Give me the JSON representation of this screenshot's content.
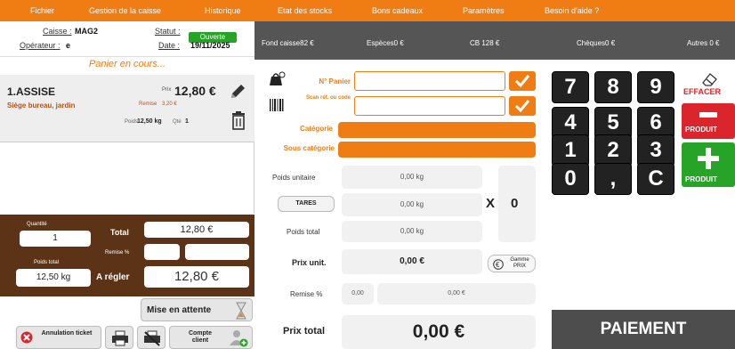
{
  "menu": {
    "items": [
      "Fichier",
      "Gestion de la caisse",
      "Historique",
      "Etat des stocks",
      "Bons cadeaux",
      "Paramètres",
      "Besoin d'aide ?"
    ]
  },
  "header": {
    "caisse_label": "Caisse :",
    "caisse_value": "MAG2",
    "operateur_label": "Opérateur :",
    "operateur_value": "e",
    "statut_label": "Statut :",
    "statut_value": "Ouverte",
    "date_label": "Date :",
    "date_value": "19/11/2025"
  },
  "totals_bar": {
    "fond_caisse": "Fond caisse82 €",
    "especes": "Espèces0 €",
    "cb": "CB 128 €",
    "cheques": "Chèques0 €",
    "autres": "Autres 0 €"
  },
  "cart": {
    "title": "Panier en cours...",
    "item": {
      "name": "1.ASSISE",
      "desc": "Siège bureau, jardin",
      "prix_label": "Prix",
      "prix": "12,80 €",
      "remise_label": "Remise",
      "remise": "3,20 €",
      "poids_label": "Poids",
      "poids": "12,50 kg",
      "qte_label": "Qté",
      "qte": "1"
    }
  },
  "summary": {
    "quantite_label": "Quantité",
    "quantite": "1",
    "total_label": "Total",
    "total": "12,80 €",
    "remise_label": "Remise %",
    "poids_total_label": "Poids total",
    "poids_total": "12,50 kg",
    "a_regler_label": "A régler",
    "a_regler": "12,80 €"
  },
  "actions": {
    "mise_en_attente": "Mise en attente",
    "annulation_ticket": "Annulation ticket",
    "compte_client": "Compte client"
  },
  "form": {
    "num_panier_label": "N° Panier",
    "scan_label": "Scan réf. ou code",
    "categorie_label": "Catégorie",
    "sous_categorie_label": "Sous catégorie",
    "poids_unitaire_label": "Poids unitaire",
    "poids_unitaire": "0,00 kg",
    "tares_label": "TARES",
    "tares_value": "0,00 kg",
    "x_label": "X",
    "x_value": "0",
    "poids_total_label": "Poids total",
    "poids_total": "0,00 kg",
    "prix_unit_label": "Prix unit.",
    "prix_unit": "0,00 €",
    "gamme_prix_label": "Gamme PRIX",
    "remise_label": "Remise %",
    "remise_pct": "0,00",
    "remise_value": "0,00 €",
    "prix_total_label": "Prix total",
    "prix_total": "0,00 €"
  },
  "keypad": {
    "keys": [
      "7",
      "8",
      "9",
      "4",
      "5",
      "6",
      "1",
      "2",
      "3",
      "0",
      ",",
      "C"
    ],
    "effacer_label": "EFFACER",
    "remove_label": "PRODUIT",
    "add_label": "PRODUIT",
    "paiement_label": "PAIEMENT"
  },
  "colors": {
    "orange": "#f07d14",
    "brown": "#5c3317",
    "green": "#27a327",
    "red": "#d9252b"
  }
}
